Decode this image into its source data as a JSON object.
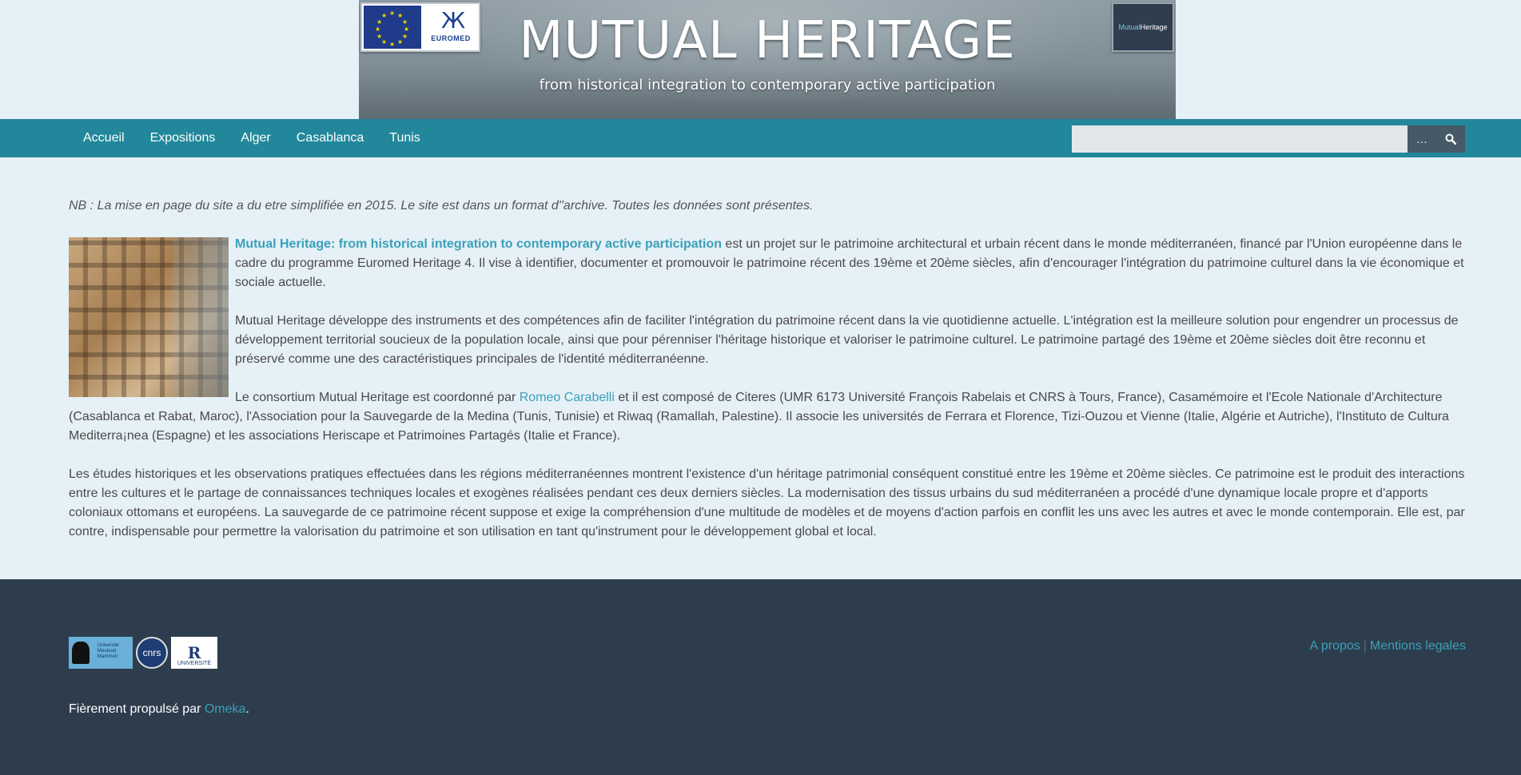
{
  "banner": {
    "title": "MUTUAL HERITAGE",
    "subtitle": "from historical integration to contemporary active participation",
    "euromed_label": "EUROMED",
    "logo_mutual": "Mutual",
    "logo_heritage": "Heritage"
  },
  "nav": {
    "items": [
      "Accueil",
      "Expositions",
      "Alger",
      "Casablanca",
      "Tunis"
    ]
  },
  "search": {
    "placeholder": "",
    "advanced_label": "…",
    "submit_icon": "search-icon"
  },
  "content": {
    "nb": "NB : La mise en page du site a du etre simplifiée en 2015. Le site est dans un format d''archive. Toutes les données sont présentes.",
    "p1_link": "Mutual Heritage: from historical integration to contemporary active participation",
    "p1_text": " est un projet sur le patrimoine architectural et urbain récent dans le monde méditerranéen, financé par l'Union européenne dans le cadre du programme Euromed Heritage 4. Il vise à identifier, documenter et promouvoir le patrimoine récent des 19ème et 20ème siècles, afin d'encourager l'intégration du patrimoine culturel dans la vie économique et sociale actuelle.",
    "p2": "Mutual Heritage développe des instruments et des compétences afin de faciliter l'intégration du patrimoine récent dans la vie quotidienne actuelle. L'intégration est la meilleure solution pour engendrer un processus de développement territorial soucieux de la population locale, ainsi que pour pérenniser l'héritage historique et valoriser le patrimoine culturel. Le patrimoine partagé des 19ème et 20ème siècles doit être reconnu et préservé comme une des caractéristiques principales de l'identité méditerranéenne.",
    "p3_before": "Le consortium Mutual Heritage est coordonné par ",
    "p3_link": "Romeo Carabelli",
    "p3_after": " et il est composé de Citeres (UMR 6173 Université François Rabelais et CNRS à Tours, France), Casamémoire et l'Ecole Nationale d'Architecture (Casablanca et Rabat, Maroc), l'Association pour la Sauvegarde de la Medina (Tunis, Tunisie) et Riwaq (Ramallah, Palestine). Il associe les universités de Ferrara et Florence, Tizi-Ouzou et Vienne (Italie, Algérie et Autriche), l'Instituto de Cultura Mediterra¡nea (Espagne) et les associations Heriscape et Patrimoines Partagés (Italie et France).",
    "p4": "Les études historiques et les observations pratiques effectuées dans les régions méditerranéennes montrent l'existence d'un héritage patrimonial conséquent constitué entre les 19ème et 20ème siècles. Ce patrimoine est le produit des interactions entre les cultures et le partage de connaissances techniques locales et exogènes réalisées pendant ces deux derniers siècles. La modernisation des tissus urbains du sud méditerranéen a procédé d'une dynamique locale propre et d'apports coloniaux ottomans et européens. La sauvegarde de ce patrimoine récent suppose et exige la compréhension d'une multitude de modèles et de moyens d'action parfois en conflit les uns avec les autres et avec le monde contemporain. Elle est, par contre, indispensable pour permettre la valorisation du patrimoine et son utilisation en tant qu'instrument pour le développement global et local."
  },
  "footer": {
    "links": [
      "A propos",
      "Mentions legales"
    ],
    "separator": "|",
    "powered_before": "Fièrement propulsé par ",
    "powered_link": "Omeka",
    "powered_after": ".",
    "logo_cnrs": "cnrs",
    "logo_univ_mark": "R",
    "logo_univ_label": "UNIVERSITÉ"
  },
  "colors": {
    "nav_bg": "#22879a",
    "footer_bg": "#2e3d4d",
    "link": "#3aa0b8",
    "page_bg": "#e6f0f7"
  }
}
